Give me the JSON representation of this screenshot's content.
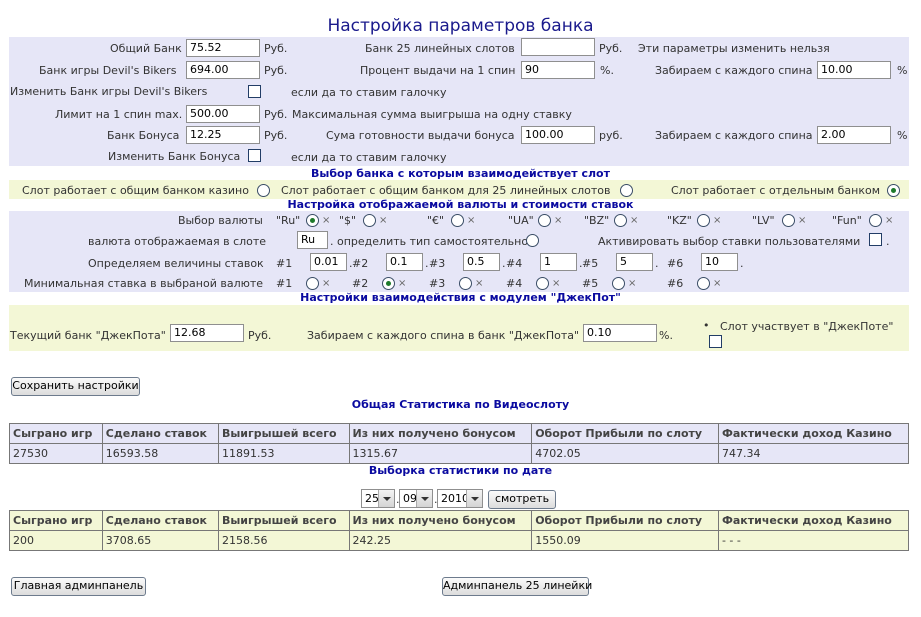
{
  "title": "Настройка параметров банка",
  "bank": {
    "common_label": "Общий Банк",
    "common_value": "75.52",
    "devil_label": "Банк игры Devil's Bikers",
    "devil_value": "694.00",
    "change_devil_label": "Изменить Банк игры Devil's Bikers",
    "checkbox_hint1": "если да то ставим галочку",
    "limit_label": "Лимит на 1 спин max.",
    "limit_value": "500.00",
    "limit_note": "Максимальная сумма выигрыша на одну ставку",
    "bonus_label": "Банк Бонуса",
    "bonus_value": "12.25",
    "change_bonus_label": "Изменить Банк Бонуса",
    "checkbox_hint2": "если да то ставим галочку",
    "bank25_label": "Банк 25 линейных слотов",
    "bank25_value": "",
    "readonly_note": "Эти параметры изменить нельзя",
    "payout_label": "Процент выдачи на 1 спин",
    "payout_value": "90",
    "take_label1": "Забираем с каждого спина",
    "take_value1": "10.00",
    "bonus_ready_label": "Сума готовности выдачи бонуса",
    "bonus_ready_value": "100.00",
    "take_label2": "Забираем с каждого спина",
    "take_value2": "2.00",
    "rub": "Руб.",
    "rub_lower": "руб.",
    "pct": "%.",
    "pct2": "%"
  },
  "bank_select": {
    "heading": "Выбор банка с которым взаимодействует слот",
    "opt1": "Слот работает с общим банком казино",
    "opt2": "Слот работает с общим банком для 25 линейных слотов",
    "opt3": "Слот работает с отдельным банком",
    "selected": 3
  },
  "currency": {
    "heading": "Настройка отображаемой валюты и стоимости ставок",
    "choose_label": "Выбор валюты",
    "options": [
      "\"Ru\"",
      "\"$\"",
      "\"€\"",
      "\"UA\"",
      "\"BZ\"",
      "\"KZ\"",
      "\"LV\"",
      "\"Fun\""
    ],
    "selected_index": 0,
    "x_mark": "×",
    "display_label": "валюта отображаемая в слоте",
    "display_value": "Ru",
    "auto_label": ". определить тип самостоятельно",
    "user_bet_label": "Активировать выбор ставки пользователями",
    "dot": ".",
    "bets_label": "Определяем величины ставок",
    "bets": [
      {
        "num": "#1",
        "value": "0.01"
      },
      {
        "num": "#2",
        "value": "0.1"
      },
      {
        "num": "#3",
        "value": "0.5"
      },
      {
        "num": "#4",
        "value": "1"
      },
      {
        "num": "#5",
        "value": "5"
      },
      {
        "num": "#6",
        "value": "10"
      }
    ],
    "min_label": "Минимальная ставка в выбраной валюте",
    "min_nums": [
      "#1",
      "#2",
      "#3",
      "#4",
      "#5",
      "#6"
    ],
    "min_selected": 1
  },
  "jackpot": {
    "heading": "Настройки взаимодействия с модулем \"ДжекПот\"",
    "bank_label": "Текущий банк \"ДжекПота\"",
    "bank_value": "12.68",
    "take_label": "Забираем с каждого спина в банк \"ДжекПота\"",
    "take_value": "0.10",
    "participate_label": "Слот участвует в \"ДжекПоте\"",
    "bullet": "•"
  },
  "save_button": "Сохранить настройки",
  "stats": {
    "heading": "Общая Статистика по Видеослоту",
    "headers": [
      "Сыграно игр",
      "Сделано ставок",
      "Выигрышей всего",
      "Из них получено бонусом",
      "Оборот Прибыли по слоту",
      "Фактически доход Казино"
    ],
    "row": [
      "27530",
      "16593.58",
      "11891.53",
      "1315.67",
      "4702.05",
      "747.34"
    ]
  },
  "date_stats": {
    "heading": "Выборка статистики по дате",
    "day": "25",
    "month": "09",
    "year": "2010",
    "sep": ".",
    "view_button": "смотреть",
    "headers": [
      "Сыграно игр",
      "Сделано ставок",
      "Выигрышей всего",
      "Из них получено бонусом",
      "Оборот Прибыли по слоту",
      "Фактически доход Казино"
    ],
    "row": [
      "200",
      "3708.65",
      "2158.56",
      "242.25",
      "1550.09",
      "- - -"
    ]
  },
  "footer": {
    "main_admin": "Главная админпанель",
    "admin25": "Админпанель 25 линейки"
  }
}
